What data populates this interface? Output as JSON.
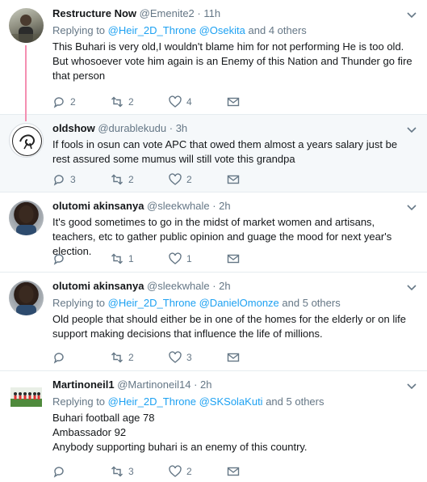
{
  "tweets": [
    {
      "name": "Restructure Now",
      "handle": "@Emenite2",
      "sep": "·",
      "time": "11h",
      "reply_prefix": "Replying to",
      "reply_1": "@Heir_2D_Throne",
      "reply_2": "@Osekita",
      "reply_suffix": "and 4 others",
      "text": "This Buhari is very old,I wouldn't blame him for not performing He is too old. But whosoever vote him again is an Enemy of this Nation and Thunder go fire that person",
      "replies": "2",
      "retweets": "2",
      "likes": "4"
    },
    {
      "name": "oldshow",
      "handle": "@durablekudu",
      "sep": "·",
      "time": "3h",
      "text": "If fools in osun can vote APC that owed them almost a years salary just be rest assured some mumus will still vote this grandpa",
      "replies": "3",
      "retweets": "2",
      "likes": "2"
    },
    {
      "name": "olutomi akinsanya",
      "handle": "@sleekwhale",
      "sep": "·",
      "time": "2h",
      "text": "It's good sometimes to go in the midst of market women and artisans, teachers, etc to gather public opinion and guage the mood for next year's election.",
      "replies": "",
      "retweets": "1",
      "likes": "1"
    },
    {
      "name": "olutomi akinsanya",
      "handle": "@sleekwhale",
      "sep": "·",
      "time": "2h",
      "reply_prefix": "Replying to",
      "reply_1": "@Heir_2D_Throne",
      "reply_2": "@DanielOmonze",
      "reply_suffix": "and 5 others",
      "text": "Old people that should either be in one of the homes for the elderly or on life support making decisions that influence the life of millions.",
      "replies": "",
      "retweets": "2",
      "likes": "3"
    },
    {
      "name": "Martinoneil1",
      "handle": "@Martinoneil14",
      "sep": "·",
      "time": "2h",
      "reply_prefix": "Replying to",
      "reply_1": "@Heir_2D_Throne",
      "reply_2": "@SKSolaKuti",
      "reply_suffix": "and 5 others",
      "text_lines": [
        "Buhari football age 78",
        "Ambassador 92",
        "Anybody supporting buhari is an enemy of this country."
      ],
      "replies": "",
      "retweets": "3",
      "likes": "2"
    }
  ],
  "colors": {
    "link": "#1da1f2",
    "muted": "#657786",
    "thread": "#f48fb1",
    "focus_bg": "#f5f8fa"
  }
}
